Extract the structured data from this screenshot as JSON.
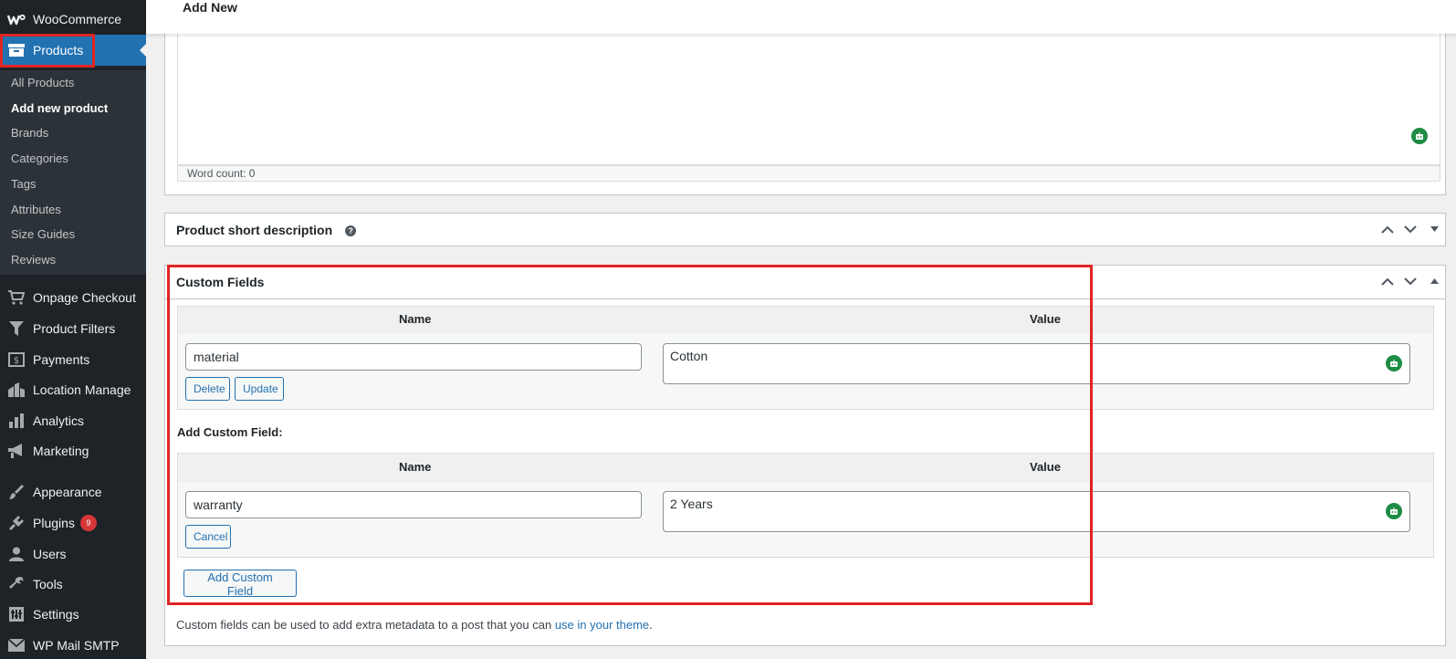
{
  "sidebar": {
    "woocommerce": "WooCommerce",
    "products": "Products",
    "submenu": [
      "All Products",
      "Add new product",
      "Brands",
      "Categories",
      "Tags",
      "Attributes",
      "Size Guides",
      "Reviews"
    ],
    "items": [
      {
        "label": "Onpage Checkout",
        "icon": "cart-icon"
      },
      {
        "label": "Product Filters",
        "icon": "filter-icon"
      },
      {
        "label": "Payments",
        "icon": "payments-icon"
      },
      {
        "label": "Location Manage",
        "icon": "location-icon"
      },
      {
        "label": "Analytics",
        "icon": "analytics-icon"
      },
      {
        "label": "Marketing",
        "icon": "megaphone-icon"
      },
      {
        "label": "Appearance",
        "icon": "paintbrush-icon"
      },
      {
        "label": "Plugins",
        "icon": "plugin-icon",
        "badge": "9"
      },
      {
        "label": "Users",
        "icon": "user-icon"
      },
      {
        "label": "Tools",
        "icon": "wrench-icon"
      },
      {
        "label": "Settings",
        "icon": "settings-icon"
      },
      {
        "label": "WP Mail SMTP",
        "icon": "mail-icon"
      }
    ]
  },
  "header": {
    "title": "Add New"
  },
  "editor": {
    "word_count": "Word count: 0"
  },
  "short_description": {
    "title": "Product short description"
  },
  "custom_fields": {
    "title": "Custom Fields",
    "name_header": "Name",
    "value_header": "Value",
    "existing": {
      "name": "material",
      "value": "Cotton",
      "delete_label": "Delete",
      "update_label": "Update"
    },
    "add_label": "Add Custom Field:",
    "new_field": {
      "name": "warranty",
      "value": "2 Years",
      "cancel_label": "Cancel"
    },
    "add_button": "Add Custom Field",
    "footer_text": "Custom fields can be used to add extra metadata to a post that you can ",
    "footer_link": "use in your theme",
    "footer_end": "."
  },
  "colors": {
    "accent": "#2271b1",
    "sidebar_bg": "#1d2327",
    "highlight": "#e02424",
    "badge": "#d63638",
    "assist_icon": "#1e8c45"
  }
}
